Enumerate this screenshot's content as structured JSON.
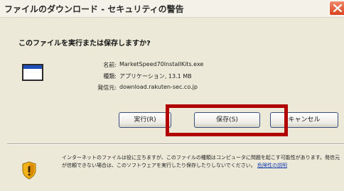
{
  "window": {
    "title": "ファイルのダウンロード - セキュリティの警告"
  },
  "prompt": {
    "question": "このファイルを実行または保存しますか?"
  },
  "file_info": {
    "name_label": "名前:",
    "name_value": "MarketSpeed70InstallKits.exe",
    "type_label": "種類:",
    "type_value": "アプリケーション, 13.1 MB",
    "from_label": "発信元:",
    "from_value": "download.rakuten-sec.co.jp"
  },
  "buttons": {
    "run": "実行(R)",
    "save": "保存(S)",
    "cancel": "キャンセル"
  },
  "warning": {
    "text": "インターネットのファイルは役に立ちますが、このファイルの種類はコンピュータに問題を起こす可能性があります。発信元が信頼できない場合は、このソフトウェアを実行したり保存したりしないでください。",
    "link": "危険性の説明"
  },
  "colors": {
    "dialog_bg": "#ece9d8",
    "highlight_frame": "#b00000",
    "link": "#1d43b0",
    "close_button": "#d9431e"
  },
  "icons": {
    "close": "close-icon",
    "file": "application-file-icon",
    "security": "security-shield-icon"
  }
}
